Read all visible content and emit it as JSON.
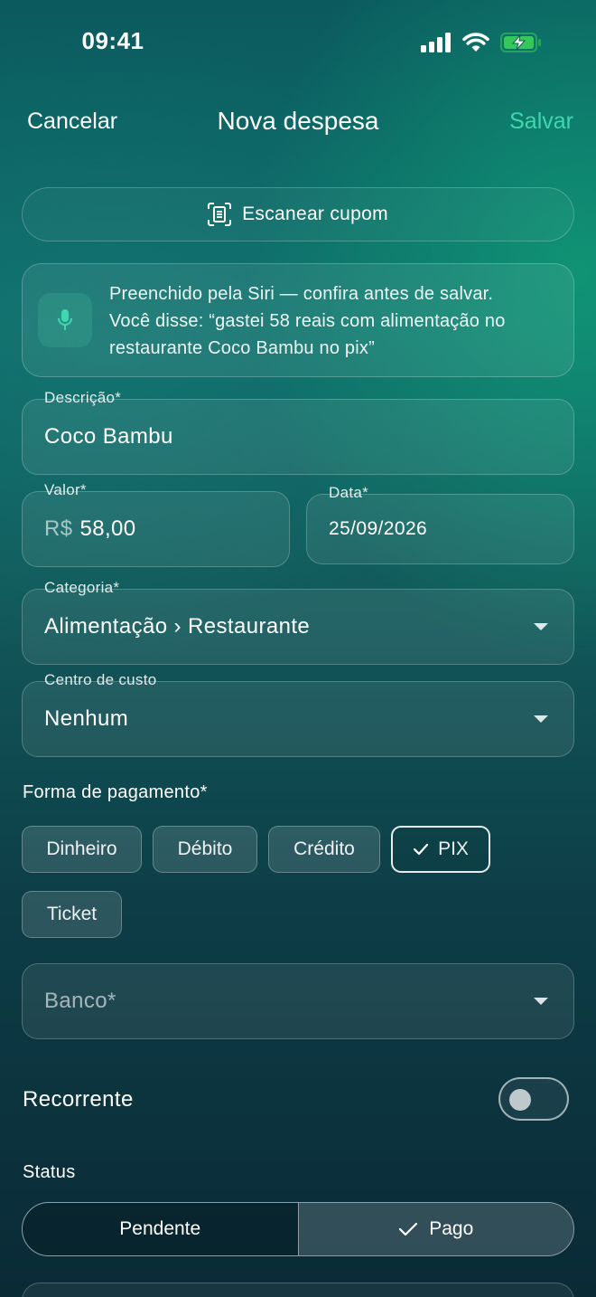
{
  "status_bar": {
    "time": "09:41"
  },
  "nav": {
    "cancel": "Cancelar",
    "title": "Nova despesa",
    "save": "Salvar",
    "save_color": "#3fd7b0"
  },
  "scan_button": {
    "label": "Escanear cupom",
    "icon": "document-scan-icon"
  },
  "siri_notice": {
    "icon": "microphone-icon",
    "line1": "Preenchido pela Siri — confira antes de salvar.",
    "line2": "Você disse: “gastei 58 reais com alimentação no",
    "line3": "restaurante Coco Bambu no pix”"
  },
  "fields": {
    "description": {
      "label": "Descrição*",
      "value": "Coco Bambu"
    },
    "amount": {
      "label": "Valor*",
      "prefix": "R$",
      "value": "58,00"
    },
    "date": {
      "label": "Data*",
      "value": "25/09/2026"
    },
    "category": {
      "label": "Categoria*",
      "value": "Alimentação › Restaurante"
    },
    "cost_center": {
      "label": "Centro de custo",
      "value": "Nenhum"
    },
    "bank": {
      "placeholder": "Banco*"
    }
  },
  "payment": {
    "label": "Forma de pagamento*",
    "options": [
      "Dinheiro",
      "Débito",
      "Crédito",
      "PIX",
      "Ticket"
    ],
    "selected": "PIX"
  },
  "recurring": {
    "label": "Recorrente",
    "enabled": false
  },
  "status": {
    "label": "Status",
    "options": [
      "Pendente",
      "Pago"
    ],
    "selected": "Pago"
  }
}
